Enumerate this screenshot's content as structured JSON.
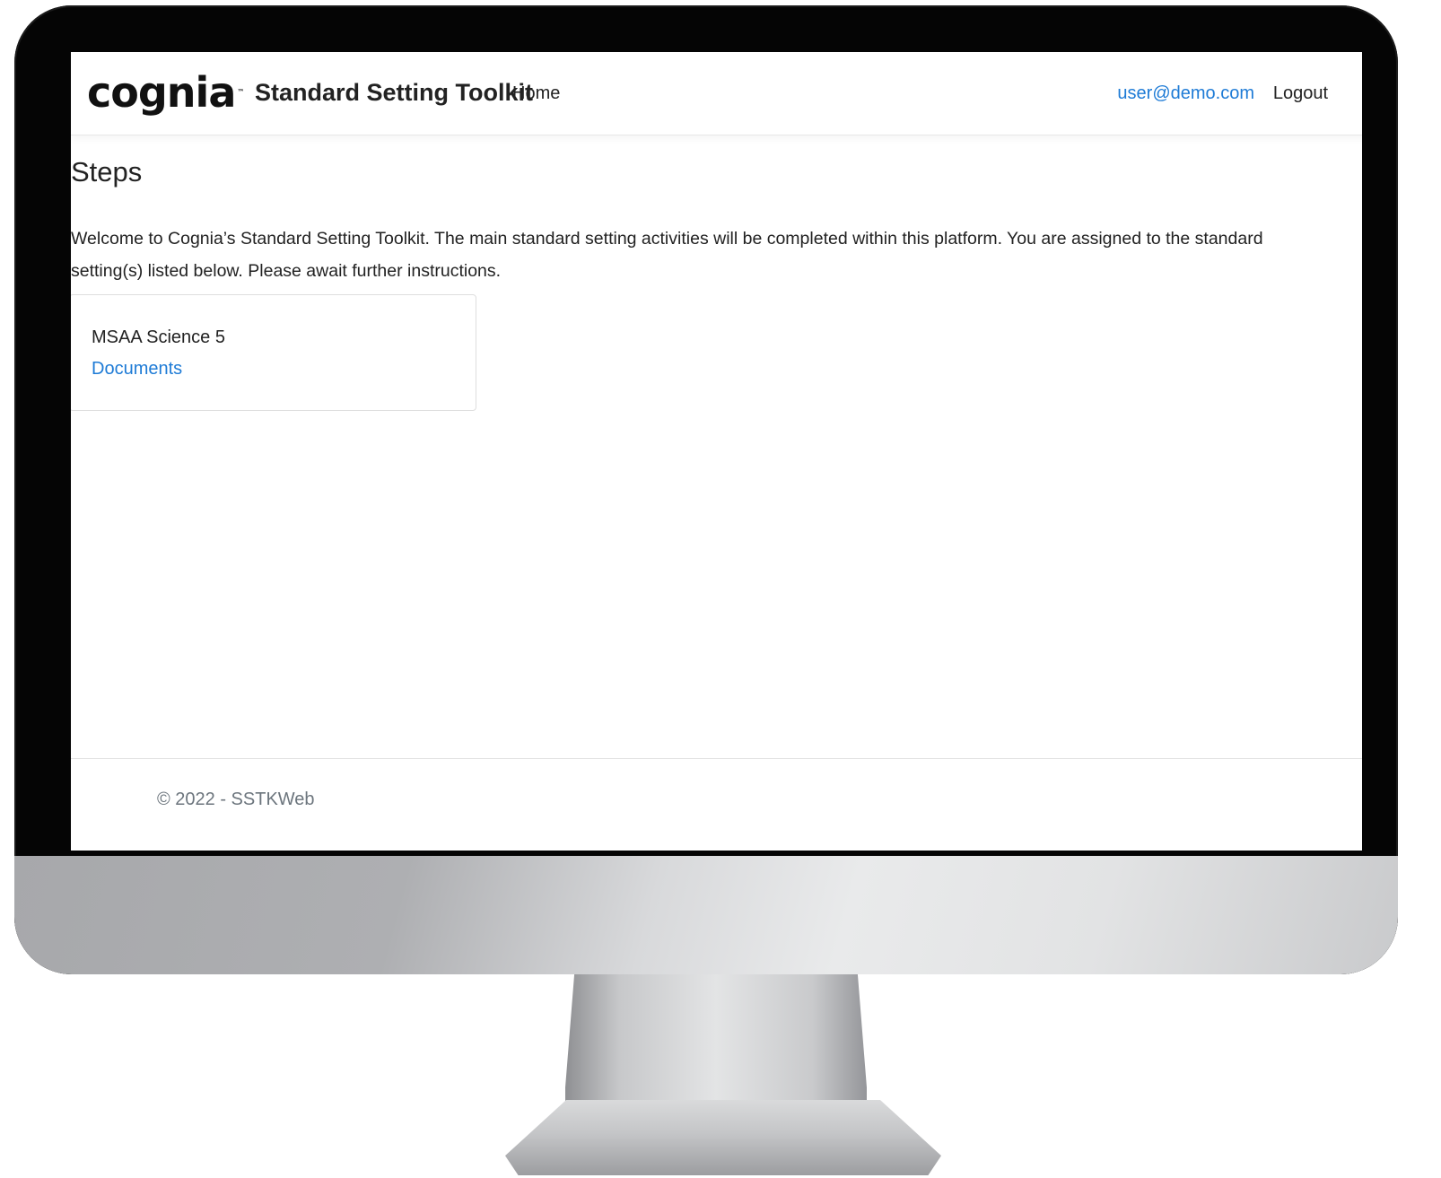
{
  "navbar": {
    "logo_text": "cognia",
    "brand": "Standard Setting Toolkit",
    "home": "Home",
    "user": "user@demo.com",
    "logout": "Logout"
  },
  "main": {
    "title": "Steps",
    "intro": "Welcome to Cognia’s Standard Setting Toolkit. The main standard setting activities will be completed within this platform. You are assigned to the standard setting(s) listed below. Please await further instructions.",
    "cards": [
      {
        "title": "MSAA Science 5",
        "link": "Documents"
      }
    ]
  },
  "footer": {
    "text": "© 2022 - SSTKWeb"
  },
  "colors": {
    "link": "#1e7bd6",
    "text": "#222222",
    "logo_dot": "#e4574f",
    "footer_text": "#6c757d"
  }
}
